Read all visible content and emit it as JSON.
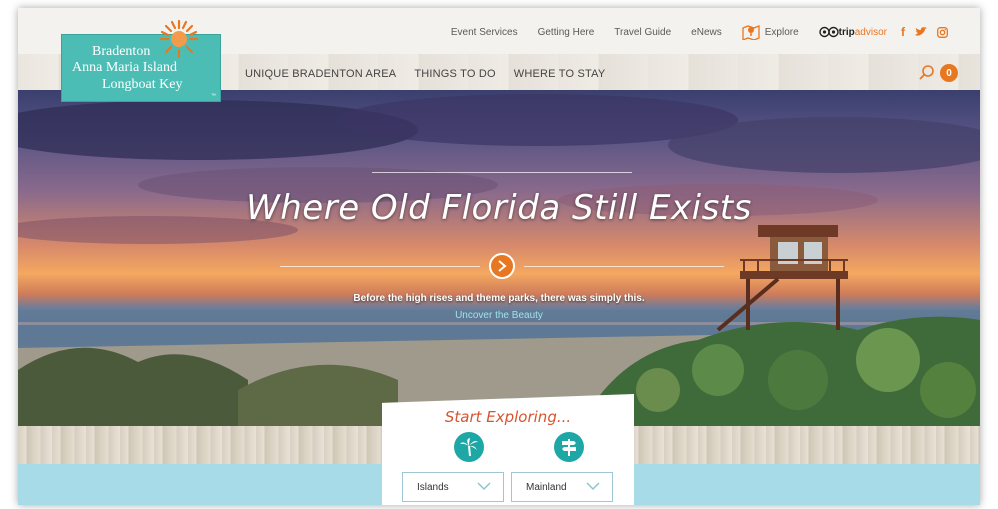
{
  "brand": {
    "line1": "Bradenton",
    "line2": "Anna Maria Island",
    "line3": "Longboat Key",
    "tm": "™"
  },
  "utility_nav": {
    "links": [
      "Event Services",
      "Getting Here",
      "Travel Guide",
      "eNews"
    ],
    "explore_label": "Explore",
    "tripadvisor_trip": "trip",
    "tripadvisor_advisor": "advisor"
  },
  "main_nav": {
    "items": [
      "UNIQUE BRADENTON AREA",
      "THINGS TO DO",
      "WHERE TO STAY"
    ],
    "cart_count": "0"
  },
  "hero": {
    "title": "Where Old Florida Still Exists",
    "subtitle": "Before the high rises and theme parks, there was simply this.",
    "link": "Uncover the Beauty"
  },
  "explore_panel": {
    "title": "Start Exploring...",
    "islands_label": "Islands",
    "mainland_label": "Mainland"
  },
  "colors": {
    "accent_orange": "#e87722",
    "brand_teal": "#4cbdb5",
    "explore_red": "#d8532e",
    "water_blue": "#a7dbe8"
  }
}
